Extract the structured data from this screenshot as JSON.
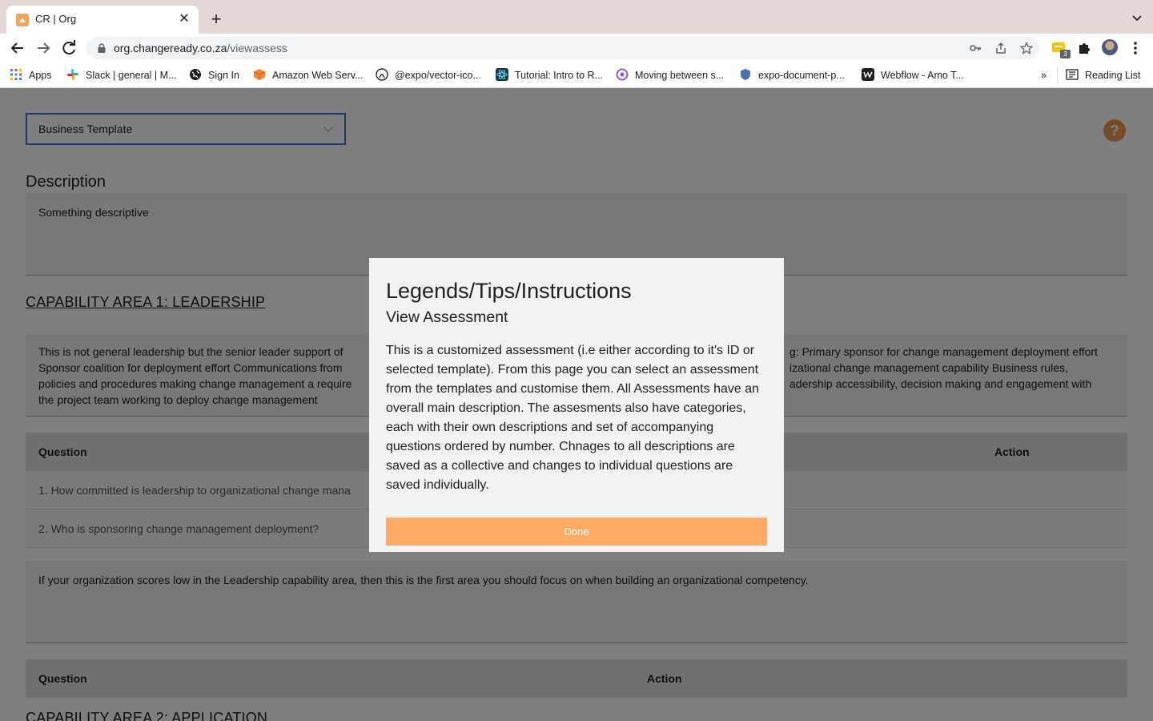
{
  "browser": {
    "tab_title": "CR | Org",
    "url_host": "org.changeready.co.za",
    "url_path": "/viewassess",
    "extension_badge": "3",
    "bookmarks": [
      {
        "label": "Apps",
        "icon": "apps-grid-icon",
        "color": "#4285f4"
      },
      {
        "label": "Slack | general | M...",
        "icon": "slack-icon",
        "color": "#e01e5a"
      },
      {
        "label": "Sign In",
        "icon": "globe-icon",
        "color": "#202124"
      },
      {
        "label": "Amazon Web Serv...",
        "icon": "aws-cube-icon",
        "color": "#f58536"
      },
      {
        "label": "@expo/vector-ico...",
        "icon": "github-icon",
        "color": "#202124"
      },
      {
        "label": "Tutorial: Intro to R...",
        "icon": "react-icon",
        "color": "#1f6f6f"
      },
      {
        "label": "Moving between s...",
        "icon": "circle-icon",
        "color": "#8e59d6"
      },
      {
        "label": "expo-document-p...",
        "icon": "shield-icon",
        "color": "#4a6fb5"
      },
      {
        "label": "Webflow - Amo T...",
        "icon": "webflow-icon",
        "color": "#202124"
      }
    ],
    "reading_list": "Reading List"
  },
  "page": {
    "template_select": "Business Template",
    "help_label": "?",
    "description_heading": "Description",
    "description_text": "Something descriptive",
    "capability1_heading": "CAPABILITY AREA 1: LEADERSHIP",
    "capability1_desc_left": "This is not general leadership but the senior leader support of",
    "capability1_desc_right": "g:  Primary sponsor for change management deployment effort",
    "capability1_desc_line2_left": "Sponsor coalition for deployment effort Communications from",
    "capability1_desc_line2_right": "izational change management capability Business rules,",
    "capability1_desc_line3_left": "policies and procedures making change management a require",
    "capability1_desc_line3_right": "adership accessibility, decision making and engagement with",
    "capability1_desc_line4": "the project team working to deploy change management",
    "table1_col_question": "Question",
    "table1_col_action": "Action",
    "question1": "1. How committed is leadership to organizational change mana",
    "question2": "2. Who is sponsoring change management deployment?",
    "capability1_focus": "If your organization scores low in the Leadership capability area, then this is the first area you should focus on when building an organizational competency.",
    "table2_col_question": "Question",
    "table2_col_action": "Action",
    "capability2_heading": "CAPABILITY AREA 2: APPLICATION"
  },
  "modal": {
    "title": "Legends/Tips/Instructions",
    "subtitle": "View Assessment",
    "body": "This is a customized assessment (i.e either according to it's ID or selected template). From this page you can select an assessment from the templates and customise them. All Assessments have an overall main description. The assesments also have categories, each with their own descriptions and set of accompanying questions ordered by number. Chnages to all descriptions are saved as a collective and changes to individual questions are saved individually.",
    "done_label": "Done"
  },
  "colors": {
    "accent_orange": "#ffab66",
    "select_border": "#3f6ed9"
  }
}
